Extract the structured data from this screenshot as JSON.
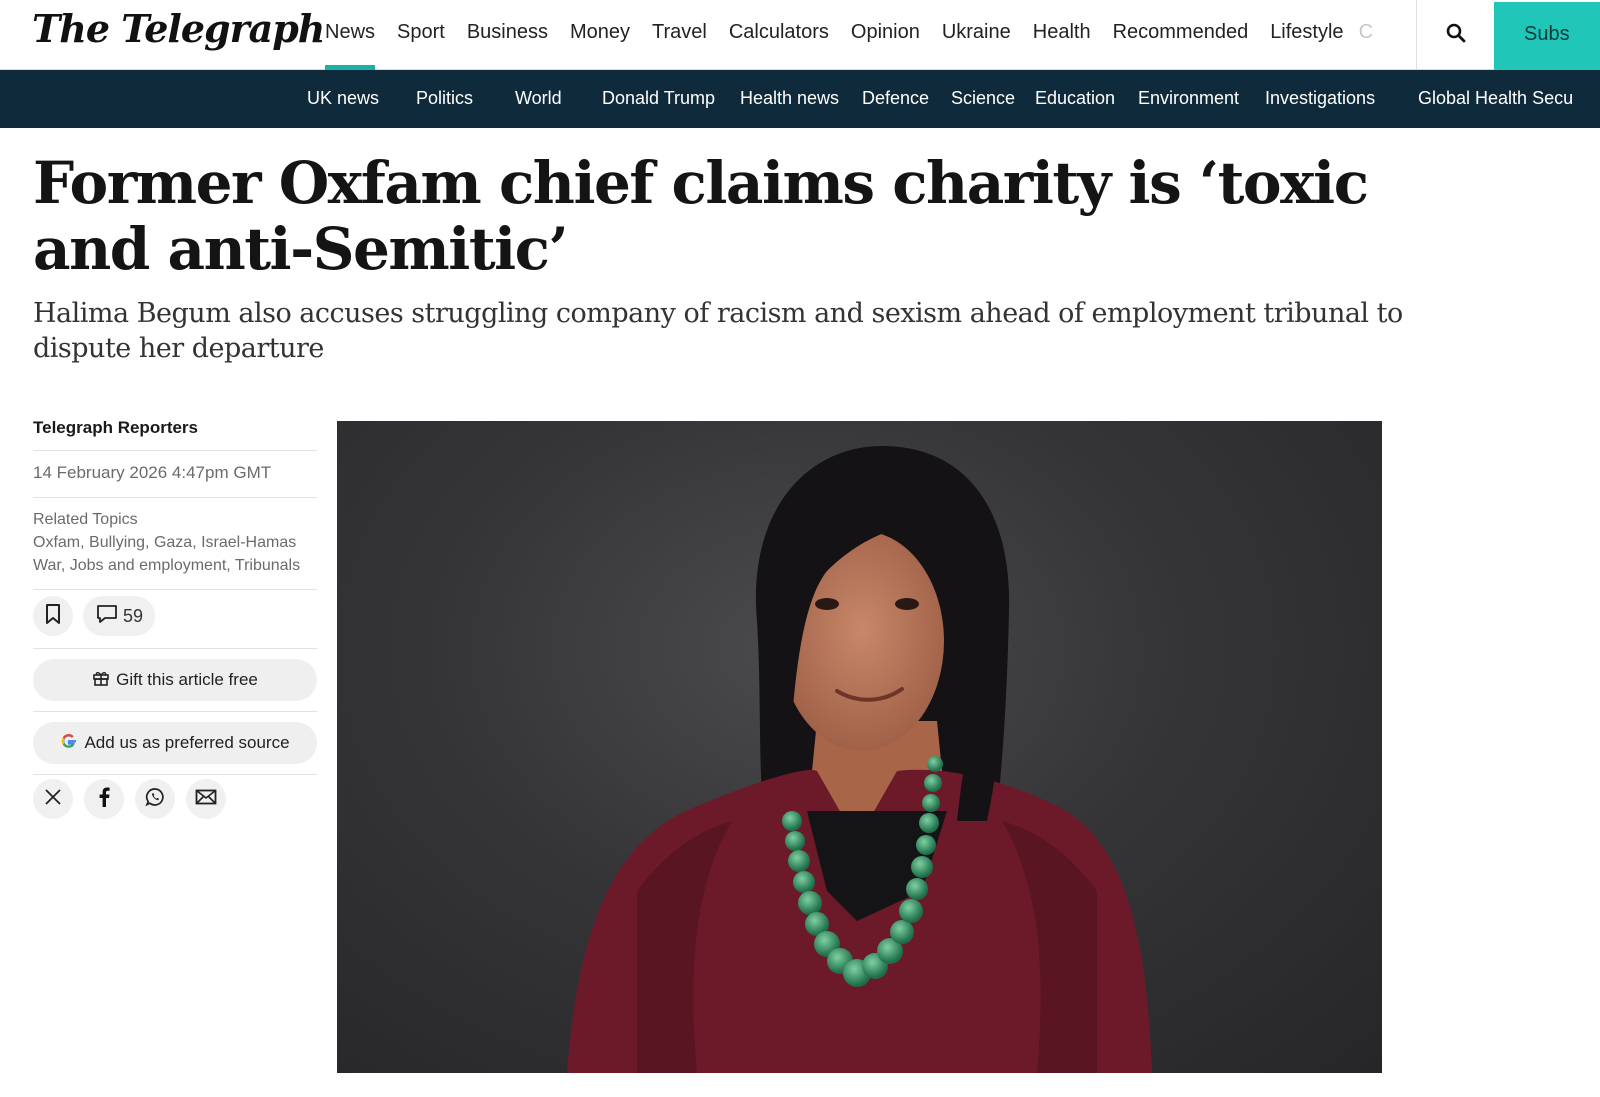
{
  "header": {
    "logo": "The Telegraph",
    "nav": [
      {
        "label": "News",
        "active": true
      },
      {
        "label": "Sport"
      },
      {
        "label": "Business"
      },
      {
        "label": "Money"
      },
      {
        "label": "Travel"
      },
      {
        "label": "Calculators"
      },
      {
        "label": "Opinion"
      },
      {
        "label": "Ukraine"
      },
      {
        "label": "Health"
      },
      {
        "label": "Recommended"
      },
      {
        "label": "Lifestyle"
      },
      {
        "label": "C"
      }
    ],
    "search_icon": "search-icon",
    "subscribe_label": "Subs"
  },
  "subnav": [
    "UK news",
    "Politics",
    "World",
    "Donald Trump",
    "Health news",
    "Defence",
    "Science",
    "Education",
    "Environment",
    "Investigations",
    "Global Health Secu"
  ],
  "article": {
    "headline": "Former Oxfam chief claims charity is ‘toxic and anti-Semitic’",
    "standfirst": "Halima Begum also accuses struggling company of racism and sexism ahead of employment tribunal to dispute her departure",
    "author": "Telegraph Reporters",
    "date": "14 February 2026 4:47pm GMT",
    "related_title": "Related Topics",
    "topics": [
      "Oxfam",
      "Bullying",
      "Gaza",
      "Israel-Hamas War",
      "Jobs and employment",
      "Tribunals"
    ],
    "comments_count": "59",
    "gift_label": "Gift this article free",
    "preferred_label": "Add us as preferred source",
    "share_icons": [
      "x-icon",
      "facebook-icon",
      "whatsapp-icon",
      "email-icon"
    ]
  },
  "colors": {
    "accent": "#20c6b8",
    "subnav_bg": "#0f2a3a"
  }
}
